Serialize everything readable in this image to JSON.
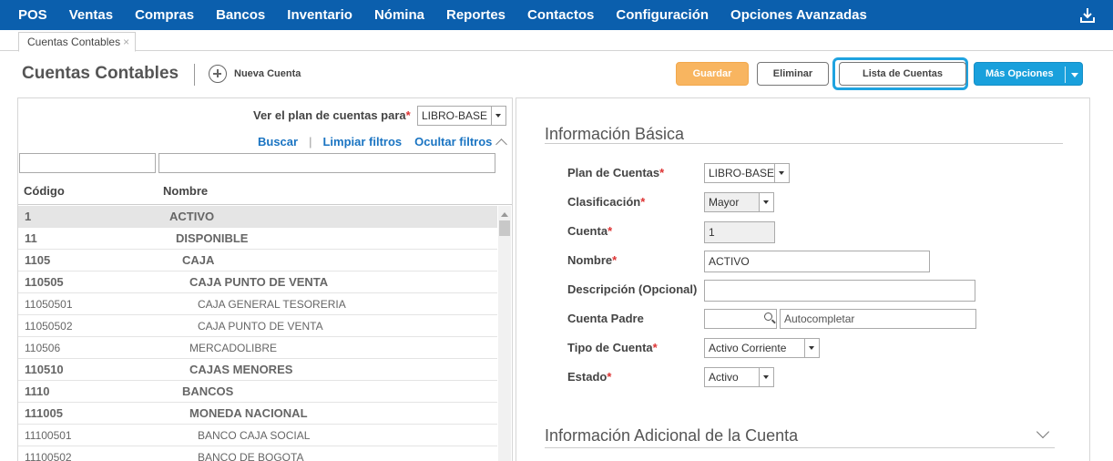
{
  "nav": {
    "items": [
      "POS",
      "Ventas",
      "Compras",
      "Bancos",
      "Inventario",
      "Nómina",
      "Reportes",
      "Contactos",
      "Configuración",
      "Opciones Avanzadas"
    ],
    "download_icon": "download-icon"
  },
  "tab": {
    "label": "Cuentas Contables",
    "close": "×"
  },
  "header": {
    "title": "Cuentas Contables",
    "new_account": "Nueva Cuenta",
    "save": "Guardar",
    "delete": "Eliminar",
    "list": "Lista de Cuentas",
    "more": "Más Opciones"
  },
  "left": {
    "plan_label": "Ver el plan de cuentas para",
    "plan_value": "LIBRO-BASE",
    "search": "Buscar",
    "clear": "Limpiar filtros",
    "hide": "Ocultar filtros",
    "col_code": "Código",
    "col_name": "Nombre",
    "rows": [
      {
        "code": "1",
        "name": "ACTIVO",
        "level": 0,
        "bold": true,
        "selected": true
      },
      {
        "code": "11",
        "name": "DISPONIBLE",
        "level": 1,
        "bold": true
      },
      {
        "code": "1105",
        "name": "CAJA",
        "level": 2,
        "bold": true
      },
      {
        "code": "110505",
        "name": "CAJA PUNTO DE VENTA",
        "level": 3,
        "bold": true
      },
      {
        "code": "11050501",
        "name": "CAJA GENERAL TESORERIA",
        "level": 4,
        "bold": false
      },
      {
        "code": "11050502",
        "name": "CAJA PUNTO DE VENTA",
        "level": 4,
        "bold": false
      },
      {
        "code": "110506",
        "name": "MERCADOLIBRE",
        "level": 3,
        "bold": false
      },
      {
        "code": "110510",
        "name": "CAJAS MENORES",
        "level": 3,
        "bold": true
      },
      {
        "code": "1110",
        "name": "BANCOS",
        "level": 2,
        "bold": true
      },
      {
        "code": "111005",
        "name": "MONEDA NACIONAL",
        "level": 3,
        "bold": true
      },
      {
        "code": "11100501",
        "name": "BANCO CAJA SOCIAL",
        "level": 4,
        "bold": false
      },
      {
        "code": "11100502",
        "name": "BANCO DE BOGOTA",
        "level": 4,
        "bold": false
      }
    ]
  },
  "right": {
    "basic_title": "Información Básica",
    "extra_title": "Información Adicional de la Cuenta",
    "fields": {
      "plan": {
        "label": "Plan de Cuentas",
        "value": "LIBRO-BASE"
      },
      "classification": {
        "label": "Clasificación",
        "value": "Mayor"
      },
      "account": {
        "label": "Cuenta",
        "value": "1"
      },
      "name": {
        "label": "Nombre",
        "value": "ACTIVO"
      },
      "description": {
        "label": "Descripción (Opcional)",
        "value": ""
      },
      "parent": {
        "label": "Cuenta Padre",
        "value": "",
        "placeholder": "Autocompletar"
      },
      "type": {
        "label": "Tipo de Cuenta",
        "value": "Activo Corriente"
      },
      "status": {
        "label": "Estado",
        "value": "Activo"
      }
    }
  },
  "colors": {
    "nav_bg": "#0b5fad",
    "save_btn": "#f8b560",
    "more_btn": "#19a0dc",
    "link": "#1a74c2",
    "highlight": "#1fa3e0"
  }
}
